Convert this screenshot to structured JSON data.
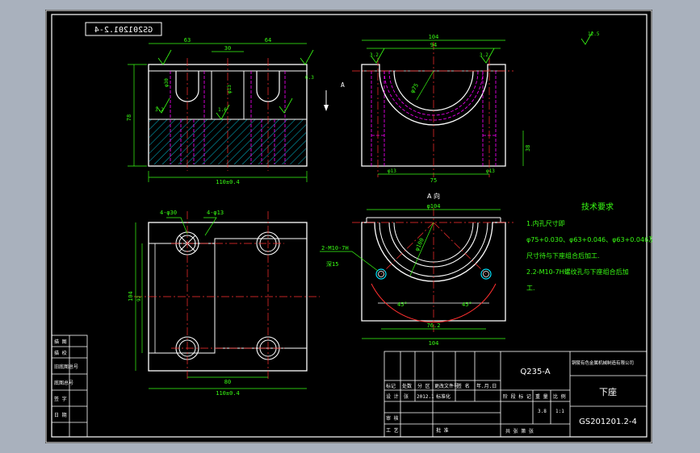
{
  "drawing_code_mirrored": "GS201201.2-4",
  "part_name": "下座",
  "material": "Q235-A",
  "company": "铜陵有色金属机械制造有限公司",
  "drawing_number": "GS201201.2-4",
  "view_label": "A 向",
  "view_arrow_label": "A",
  "roughness_general": "12.5",
  "tech_requirements": {
    "title": "技术要求",
    "lines": [
      "1.内孔尺寸即",
      "φ75+0.030、φ63+0.046、φ63+0.046及R51",
      "尺寸待与下座组合后加工.",
      "2.2-M10-7H螺纹孔与下座组合后加",
      "工."
    ]
  },
  "dimensions": {
    "front_total": "63",
    "front_right": "64",
    "front_mid": "30",
    "front_height": "78",
    "front_width": "110±0.4",
    "side_top": "104",
    "side_inner": "94",
    "side_bore": "φ75",
    "side_bottom": "75",
    "side_height": "38",
    "plan_holes_left": "4-φ30",
    "plan_holes_right": "4-φ13",
    "plan_center": "80",
    "plan_width": "110±0.4",
    "plan_height": "104",
    "aview_top": "φ104",
    "aview_bore": "φ100",
    "aview_thread": "2-M10-7H",
    "aview_depth": "深15",
    "aview_angle_left": "45°",
    "aview_angle_right": "45°",
    "aview_center": "76.2",
    "aview_width": "104",
    "roughness_a": "3.2",
    "roughness_b": "1.6",
    "roughness_c": "6.3"
  },
  "title_block": {
    "row_labels": [
      "描 图",
      "描 校",
      "旧底图总号",
      "底图总号",
      "签 字",
      "日 期"
    ],
    "change_headers": [
      "标记",
      "处数",
      "分 区",
      "更改文件号",
      "签 名",
      "年.月.日"
    ],
    "design_label": "设 计",
    "designer": "张",
    "date": "2012.1",
    "standardize_label": "标准化",
    "review_label": "审 核",
    "process_label": "工 艺",
    "approve_label": "批 准",
    "stage_label": "阶 段 标 记",
    "weight_label": "重 量",
    "scale_label": "比 例",
    "weight": "3.8",
    "scale": "1:1",
    "sheet_text": "共   张   第   张"
  }
}
